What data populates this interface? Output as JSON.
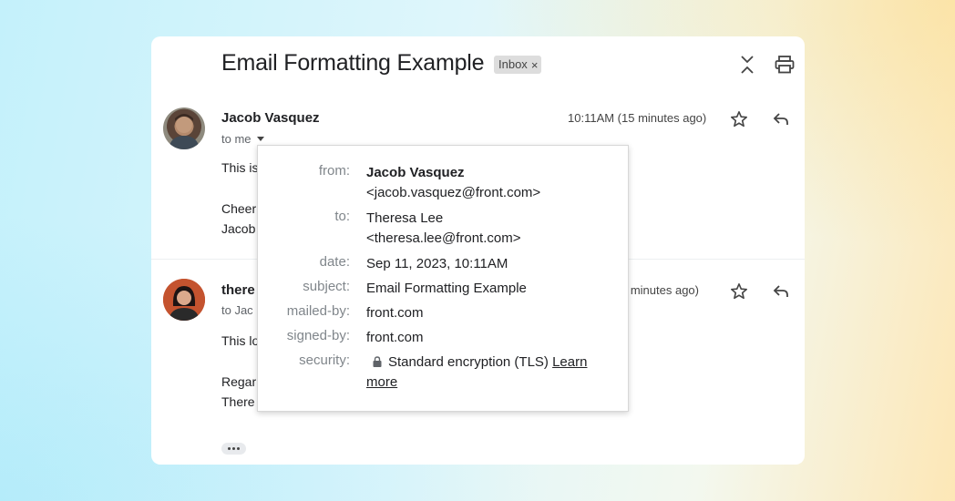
{
  "email": {
    "subject": "Email Formatting Example",
    "label": "Inbox",
    "label_remove": "×"
  },
  "messages": [
    {
      "sender": "Jacob Vasquez",
      "to": "to me",
      "time": "10:11AM (15 minutes ago)",
      "body": [
        "This is",
        "Cheer",
        "Jacob"
      ]
    },
    {
      "sender": "there",
      "to": "to Jac",
      "time": "2 minutes ago)",
      "body": [
        "This lo",
        "Regar",
        "There"
      ]
    }
  ],
  "details_popup": {
    "from_label": "from:",
    "from_name": "Jacob Vasquez",
    "from_email": "<jacob.vasquez@front.com>",
    "to_label": "to:",
    "to_name": "Theresa Lee",
    "to_email": "<theresa.lee@front.com>",
    "date_label": "date:",
    "date_value": "Sep 11, 2023, 10:11AM",
    "subject_label": "subject:",
    "subject_value": "Email Formatting Example",
    "mailed_by_label": "mailed-by:",
    "mailed_by_value": "front.com",
    "signed_by_label": "signed-by:",
    "signed_by_value": "front.com",
    "security_label": "security:",
    "security_value": "Standard encryption (TLS)",
    "learn_more": "Learn",
    "learn_more_2": "more"
  },
  "icons": {
    "collapse": "collapse-all-icon",
    "print": "print-icon",
    "star": "star-icon",
    "reply": "reply-icon",
    "lock": "lock-icon",
    "more": "more-dots-icon"
  },
  "colors": {
    "card_bg": "#ffffff",
    "chip_bg": "#dddddd",
    "label_gray": "#80868b"
  }
}
